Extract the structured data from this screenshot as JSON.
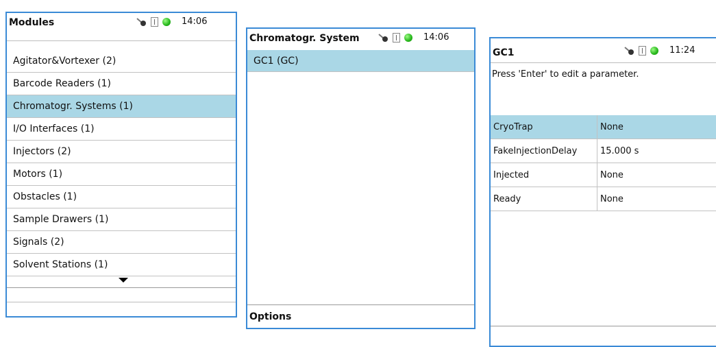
{
  "modules_panel": {
    "title": "Modules",
    "time": "14:06",
    "items": [
      {
        "label": "Agitator&Vortexer (2)"
      },
      {
        "label": "Barcode Readers (1)"
      },
      {
        "label": "Chromatogr. Systems (1)",
        "selected": true
      },
      {
        "label": "I/O Interfaces (1)"
      },
      {
        "label": "Injectors (2)"
      },
      {
        "label": "Motors (1)"
      },
      {
        "label": "Obstacles (1)"
      },
      {
        "label": "Sample Drawers (1)"
      },
      {
        "label": "Signals (2)"
      },
      {
        "label": "Solvent Stations (1)"
      }
    ]
  },
  "chromatogr_panel": {
    "title": "Chromatogr. System",
    "time": "14:06",
    "items": [
      {
        "label": "GC1 (GC)",
        "selected": true
      }
    ],
    "footer": "Options"
  },
  "gc1_panel": {
    "title": "GC1",
    "time": "11:24",
    "hint": "Press 'Enter' to edit a parameter.",
    "params": [
      {
        "name": "CryoTrap",
        "value": "None",
        "selected": true
      },
      {
        "name": "FakeInjectionDelay",
        "value": "15.000 s"
      },
      {
        "name": "Injected",
        "value": "None"
      },
      {
        "name": "Ready",
        "value": "None"
      }
    ]
  },
  "icons": {
    "status_dot": "#2fc41f",
    "selection": "#aad7e6",
    "panel_border": "#3a8ad6"
  }
}
